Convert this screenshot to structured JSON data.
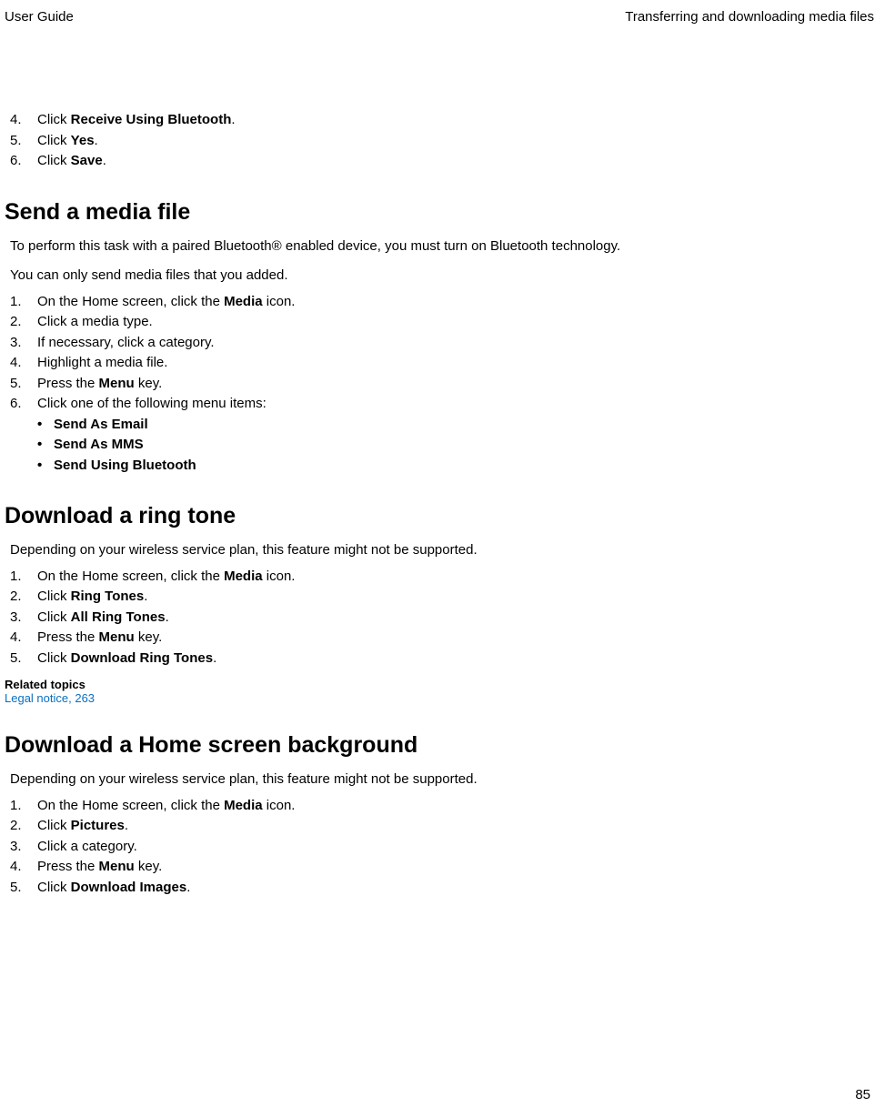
{
  "header": {
    "left": "User Guide",
    "right": "Transferring and downloading media files"
  },
  "topList": [
    {
      "n": "4.",
      "pre": "Click ",
      "b": "Receive Using Bluetooth",
      "post": "."
    },
    {
      "n": "5.",
      "pre": "Click ",
      "b": "Yes",
      "post": "."
    },
    {
      "n": "6.",
      "pre": "Click ",
      "b": "Save",
      "post": "."
    }
  ],
  "section1": {
    "title": "Send a media file",
    "intro": "To perform this task with a paired Bluetooth® enabled device, you must turn on Bluetooth technology.",
    "lead": "You can only send media files that you added.",
    "items": [
      {
        "n": "1.",
        "pre": "On the Home screen, click the ",
        "b": "Media",
        "post": " icon."
      },
      {
        "n": "2.",
        "pre": "Click a media type.",
        "b": "",
        "post": ""
      },
      {
        "n": "3.",
        "pre": "If necessary, click a category.",
        "b": "",
        "post": ""
      },
      {
        "n": "4.",
        "pre": "Highlight a media file.",
        "b": "",
        "post": ""
      },
      {
        "n": "5.",
        "pre": "Press the ",
        "b": "Menu",
        "post": " key."
      },
      {
        "n": "6.",
        "pre": "Click one of the following menu items:",
        "b": "",
        "post": ""
      }
    ],
    "bullets": [
      "Send As Email",
      "Send As MMS",
      "Send Using Bluetooth"
    ]
  },
  "section2": {
    "title": "Download a ring tone",
    "lead": "Depending on your wireless service plan, this feature might not be supported.",
    "items": [
      {
        "n": "1.",
        "pre": "On the Home screen, click the ",
        "b": "Media",
        "post": " icon."
      },
      {
        "n": "2.",
        "pre": "Click ",
        "b": "Ring Tones",
        "post": "."
      },
      {
        "n": "3.",
        "pre": "Click ",
        "b": "All Ring Tones",
        "post": "."
      },
      {
        "n": "4.",
        "pre": "Press the ",
        "b": "Menu",
        "post": " key."
      },
      {
        "n": "5.",
        "pre": "Click ",
        "b": "Download Ring Tones",
        "post": "."
      }
    ],
    "relatedHeading": "Related topics",
    "relatedLink": "Legal notice, 263"
  },
  "section3": {
    "title": "Download a Home screen background",
    "lead": "Depending on your wireless service plan, this feature might not be supported.",
    "items": [
      {
        "n": "1.",
        "pre": "On the Home screen, click the ",
        "b": "Media",
        "post": " icon."
      },
      {
        "n": "2.",
        "pre": "Click ",
        "b": "Pictures",
        "post": "."
      },
      {
        "n": "3.",
        "pre": "Click a category.",
        "b": "",
        "post": ""
      },
      {
        "n": "4.",
        "pre": "Press the ",
        "b": "Menu",
        "post": " key."
      },
      {
        "n": "5.",
        "pre": "Click ",
        "b": "Download Images",
        "post": "."
      }
    ]
  },
  "pageNumber": "85"
}
